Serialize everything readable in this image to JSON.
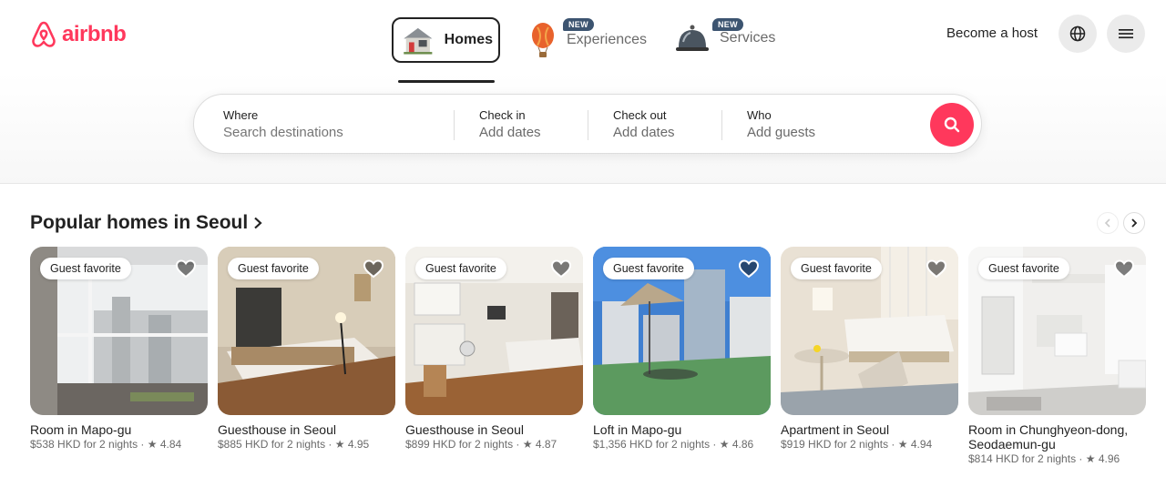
{
  "brand": {
    "name": "airbnb",
    "color": "#ff385c"
  },
  "nav": {
    "homes": "Homes",
    "experiences": "Experiences",
    "services": "Services",
    "new_badge": "NEW"
  },
  "header": {
    "host_link": "Become a host"
  },
  "search": {
    "where_label": "Where",
    "where_placeholder": "Search destinations",
    "checkin_label": "Check in",
    "checkin_value": "Add dates",
    "checkout_label": "Check out",
    "checkout_value": "Add dates",
    "who_label": "Who",
    "who_value": "Add guests"
  },
  "section": {
    "title": "Popular homes in Seoul"
  },
  "badge_label": "Guest favorite",
  "listings": [
    {
      "title": "Room in Mapo-gu",
      "price": "$538 HKD for 2 nights",
      "rating": "4.84"
    },
    {
      "title": "Guesthouse in Seoul",
      "price": "$885 HKD for 2 nights",
      "rating": "4.95"
    },
    {
      "title": "Guesthouse in Seoul",
      "price": "$899 HKD for 2 nights",
      "rating": "4.87"
    },
    {
      "title": "Loft in Mapo-gu",
      "price": "$1,356 HKD for 2 nights",
      "rating": "4.86"
    },
    {
      "title": "Apartment in Seoul",
      "price": "$919 HKD for 2 nights",
      "rating": "4.94"
    },
    {
      "title": "Room in Chunghyeon-dong, Seodaemun-gu",
      "price": "$814 HKD for 2 nights",
      "rating": "4.96"
    }
  ]
}
